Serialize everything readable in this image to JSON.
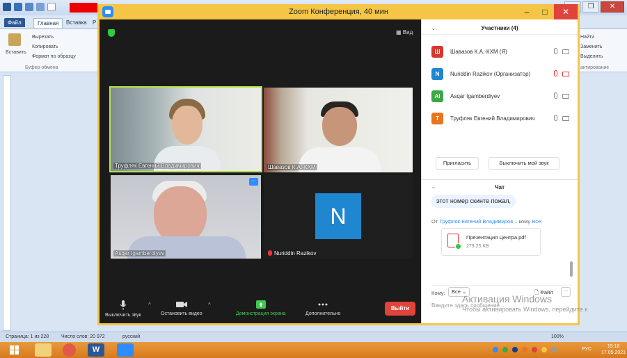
{
  "word": {
    "tabs": [
      "Файл",
      "Главная",
      "Вставка",
      "Р"
    ],
    "clipboard": {
      "paste": "Вставить",
      "cut": "Вырезать",
      "copy": "Копировать",
      "format": "Формат по образцу",
      "group": "Буфер обмена"
    },
    "editing": {
      "find": "Найти",
      "replace": "Заменить",
      "select": "Выделить",
      "group": "актирование"
    },
    "status": {
      "page": "Страница: 1 из 228",
      "words": "Число слов: 20 972",
      "language": "русский",
      "zoom": "100%"
    }
  },
  "zoom": {
    "title": "Zoom Конференция, 40 мин",
    "view_label": "Вид",
    "tiles": [
      {
        "name": "Труфляк Евгений Владимирович"
      },
      {
        "name": "Шавазов К.А.-КХМ"
      },
      {
        "name": "Asqar Igamberdiyev"
      },
      {
        "name": "Nuriddin Razikov",
        "avatar_letter": "N"
      }
    ],
    "toolbar": {
      "mute": "Выключить звук",
      "stop_video": "Остановить видео",
      "share": "Демонстрация экрана",
      "more": "Дополнительно",
      "leave": "Выйти"
    },
    "participants": {
      "title": "Участники (4)",
      "list": [
        {
          "letter": "Ш",
          "name": "Шавазов К.А.-КХМ (Я)",
          "color": "#d9352b"
        },
        {
          "letter": "N",
          "name": "Nuriddin Razikov (Организатор)",
          "color": "#1f86d0"
        },
        {
          "letter": "AI",
          "name": "Asqar Igamberdiyev",
          "color": "#3aa845"
        },
        {
          "letter": "Т",
          "name": "Труфляк Евгений Владимирович",
          "color": "#e8741c"
        }
      ],
      "invite": "Пригласить",
      "mute_me": "Выключить мой звук"
    },
    "chat": {
      "title": "Чат",
      "message": "этот номер скинте пожал,",
      "from_prefix": "От",
      "from_name": "Труфляк Евгений Владимиров...",
      "to_word": "кому",
      "to_target": "Все:",
      "file_name": "Презентация Центра.pdf",
      "file_size": "279.25 KB",
      "to_label": "Кому:",
      "to_value": "Все",
      "file_button": "Файл",
      "input_placeholder": "Введите здесь сообщение..."
    }
  },
  "watermark": {
    "title": "Активация Windows",
    "subtitle": "Чтобы активировать Windows, перейдите к"
  },
  "taskbar": {
    "language": "РУС",
    "time": "15:18",
    "date": "17.05.2021"
  }
}
